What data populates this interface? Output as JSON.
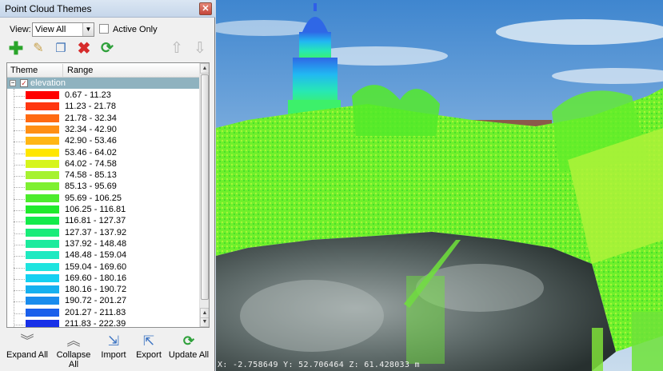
{
  "dialog": {
    "title": "Point Cloud Themes",
    "close_glyph": "✕",
    "view_label": "View:",
    "view_select_value": "View All",
    "active_only_label": "Active Only",
    "toolbar": {
      "add_icon": "plus-icon",
      "edit_icon": "pencil-icon",
      "copy_icon": "copy-icon",
      "delete_icon": "delete-x-icon",
      "refresh_icon": "refresh-icon",
      "up_icon": "arrow-up-icon",
      "down_icon": "arrow-down-icon"
    },
    "columns": {
      "theme": "Theme",
      "range": "Range"
    },
    "root": {
      "label": "elevation",
      "checked": true
    },
    "ranges": [
      {
        "label": "0.67 - 11.23",
        "color": "#ff0000"
      },
      {
        "label": "11.23 - 21.78",
        "color": "#ff3710"
      },
      {
        "label": "21.78 - 32.34",
        "color": "#ff6a12"
      },
      {
        "label": "32.34 - 42.90",
        "color": "#ff8f14"
      },
      {
        "label": "42.90 - 53.46",
        "color": "#ffb614"
      },
      {
        "label": "53.46 - 64.02",
        "color": "#ffe600"
      },
      {
        "label": "64.02 - 74.58",
        "color": "#d6f51c"
      },
      {
        "label": "74.58 - 85.13",
        "color": "#a6f230"
      },
      {
        "label": "85.13 - 95.69",
        "color": "#7ef031"
      },
      {
        "label": "95.69 - 106.25",
        "color": "#4cec2c"
      },
      {
        "label": "106.25 - 116.81",
        "color": "#20ea2c"
      },
      {
        "label": "116.81 - 127.37",
        "color": "#14eb4a"
      },
      {
        "label": "127.37 - 137.92",
        "color": "#19ec79"
      },
      {
        "label": "137.92 - 148.48",
        "color": "#1ceb9d"
      },
      {
        "label": "148.48 - 159.04",
        "color": "#1fe9c1"
      },
      {
        "label": "159.04 - 169.60",
        "color": "#1fe4df"
      },
      {
        "label": "169.60 - 180.16",
        "color": "#15d0f1"
      },
      {
        "label": "180.16 - 190.72",
        "color": "#16b0ef"
      },
      {
        "label": "190.72 - 201.27",
        "color": "#1a8ced"
      },
      {
        "label": "201.27 - 211.83",
        "color": "#1a5feb"
      },
      {
        "label": "211.83 - 222.39",
        "color": "#1730e8"
      }
    ],
    "bottom_buttons": {
      "expand_all": "Expand All",
      "collapse_all": "Collapse All",
      "import": "Import",
      "export": "Export",
      "update_all": "Update All"
    }
  },
  "viewport": {
    "coordinates": "X: -2.758649 Y: 52.706464 Z: 61.428033 m"
  }
}
